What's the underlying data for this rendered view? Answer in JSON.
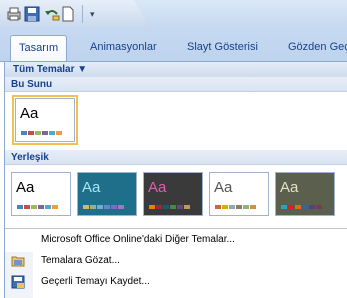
{
  "colors": {
    "ribbon_text": "#15428b",
    "tab_bg": "#c6d9f1",
    "selected_outline": "#f2c14e"
  },
  "quick_access": {
    "icons": [
      "print-preview-icon",
      "save-icon",
      "undo-icon",
      "new-document-icon",
      "customize-dropdown-icon"
    ]
  },
  "tabs": [
    {
      "label": "Tasarım",
      "active": true
    },
    {
      "label": "Animasyonlar",
      "active": false
    },
    {
      "label": "Slayt Gösterisi",
      "active": false
    },
    {
      "label": "Gözden Geç",
      "active": false
    }
  ],
  "gallery": {
    "filter_label": "Tüm Temalar ▼",
    "section_this": "Bu Sunu",
    "section_builtin": "Yerleşik",
    "thumb_text": "Aa",
    "themes_this": [
      {
        "name": "office-theme",
        "bg": "#ffffff",
        "text": "#000000",
        "selected": true,
        "bars": [
          "#4f81bd",
          "#c0504d",
          "#9bbb59",
          "#8064a2",
          "#4bacc6",
          "#f79646"
        ]
      }
    ],
    "themes_builtin": [
      {
        "name": "office-theme",
        "bg": "#ffffff",
        "text": "#000000",
        "bars": [
          "#4f81bd",
          "#c0504d",
          "#9bbb59",
          "#8064a2",
          "#4bacc6",
          "#f79646"
        ]
      },
      {
        "name": "apex-theme",
        "bg": "#1f6f8b",
        "text": "#a8e4f2",
        "bars": [
          "#ceb966",
          "#9cb084",
          "#6bb1c9",
          "#6585cf",
          "#7e6bc9",
          "#a379bb"
        ]
      },
      {
        "name": "aspect-theme",
        "bg": "#3a3a3a",
        "text": "#e05fb0",
        "bars": [
          "#f07f09",
          "#9f2936",
          "#1b587c",
          "#4e8542",
          "#604878",
          "#c19859"
        ]
      },
      {
        "name": "civic-theme",
        "bg": "#ffffff",
        "text": "#555555",
        "bars": [
          "#d16349",
          "#ccb400",
          "#8cadae",
          "#8c7b70",
          "#8fb08c",
          "#d19049"
        ]
      },
      {
        "name": "concourse-theme",
        "bg": "#5a5f4e",
        "text": "#e6e0c8",
        "bars": [
          "#2da2bf",
          "#da1f28",
          "#eb641b",
          "#39639d",
          "#474b78",
          "#7d3c4a"
        ]
      }
    ]
  },
  "menu": {
    "more_themes": "Microsoft Office Online'daki Diğer Temalar...",
    "browse_themes": "Temalara Gözat...",
    "save_theme": "Geçerli Temayı Kaydet..."
  }
}
